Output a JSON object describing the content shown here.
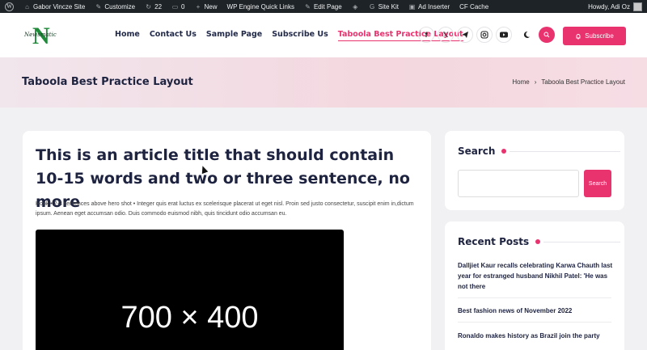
{
  "admin_bar": {
    "site_name": "Gabor Vincze Site",
    "customize": "Customize",
    "updates_count": "22",
    "comments_count": "0",
    "new_label": "New",
    "quick_links": "WP Engine Quick Links",
    "edit_page": "Edit Page",
    "site_kit": "Site Kit",
    "ad_inserter": "Ad Inserter",
    "cf_cache": "CF Cache",
    "howdy": "Howdy, Adi Oz"
  },
  "header": {
    "logo_letter": "N",
    "logo_script": "Newsmatic",
    "nav": [
      "Home",
      "Contact Us",
      "Sample Page",
      "Subscribe Us",
      "Taboola Best Practice Layout"
    ],
    "active_nav_index": 4,
    "subscribe_label": "Subscribe",
    "social_icons": [
      "facebook-icon",
      "x-icon",
      "telegram-icon",
      "instagram-icon",
      "youtube-icon"
    ]
  },
  "page_band": {
    "title": "Taboola Best Practice Layout",
    "breadcrumb_home": "Home",
    "breadcrumb_separator": "›",
    "breadcrumb_current": "Taboola Best Practice Layout"
  },
  "article": {
    "title": "This is an article title that should contain 10-15 words and two or three sentence, no more",
    "hook": "Hook • 2-3 sentences above hero shot • Integer quis erat luctus ex scelerisque placerat ut eget nisl. Proin sed justo consectetur, suscipit enim in,dictum ipsum. Aenean eget accumsan odio. Duis commodo euismod nibh, quis tincidunt odio accumsan eu.",
    "hero_placeholder": "700 × 400"
  },
  "sidebar": {
    "search_title": "Search",
    "search_button": "Search",
    "search_placeholder": "",
    "recent_title": "Recent Posts",
    "recent_posts": [
      "Dalljiet Kaur recalls celebrating Karwa Chauth last year for estranged husband Nikhil Patel: 'He was not there",
      "Best fashion news of November 2022",
      "Ronaldo makes history as Brazil join the party"
    ]
  },
  "colors": {
    "accent": "#e8336f",
    "admin_bar": "#1d2327",
    "heading": "#1e2340"
  }
}
